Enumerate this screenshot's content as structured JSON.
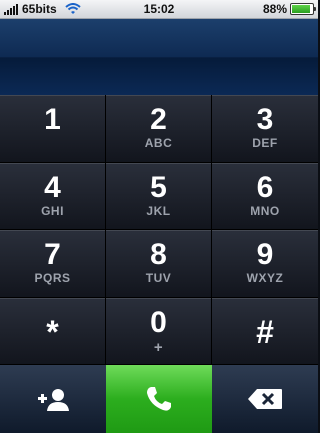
{
  "status_bar": {
    "carrier": "65bits",
    "time": "15:02",
    "battery": "88%",
    "battery_level": 0.88
  },
  "display": {
    "number": ""
  },
  "keypad": {
    "keys": [
      {
        "digit": "1",
        "letters": ""
      },
      {
        "digit": "2",
        "letters": "ABC"
      },
      {
        "digit": "3",
        "letters": "DEF"
      },
      {
        "digit": "4",
        "letters": "GHI"
      },
      {
        "digit": "5",
        "letters": "JKL"
      },
      {
        "digit": "6",
        "letters": "MNO"
      },
      {
        "digit": "7",
        "letters": "PQRS"
      },
      {
        "digit": "8",
        "letters": "TUV"
      },
      {
        "digit": "9",
        "letters": "WXYZ"
      },
      {
        "digit": "*",
        "letters": ""
      },
      {
        "digit": "0",
        "letters": "+"
      },
      {
        "digit": "#",
        "letters": ""
      }
    ]
  },
  "bottom_bar": {
    "left_icon": "add-contact-icon",
    "center_icon": "phone-icon",
    "right_icon": "backspace-icon",
    "call_color": "#2cae1e"
  }
}
